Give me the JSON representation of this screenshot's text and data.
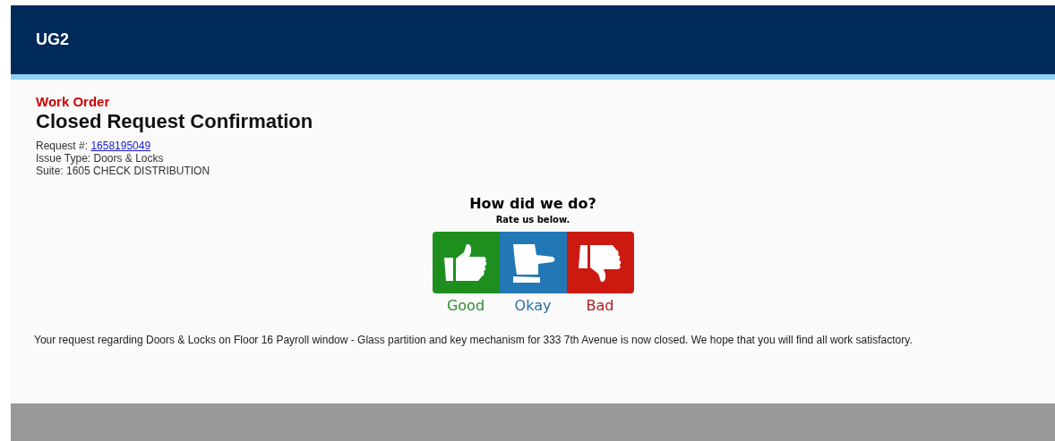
{
  "header": {
    "title": "UG2"
  },
  "page": {
    "eyebrow": "Work Order",
    "title": "Closed Request Confirmation"
  },
  "details": {
    "request_label": "Request #:",
    "request_number": "1658195049",
    "issue_type": "Issue Type: Doors & Locks",
    "suite": "Suite: 1605 CHECK DISTRIBUTION"
  },
  "rating": {
    "question": "How did we do?",
    "prompt": "Rate us below.",
    "options": [
      {
        "kind": "up",
        "label": "Good",
        "color": "#1e8f1e"
      },
      {
        "kind": "side",
        "label": "Okay",
        "color": "#2277b5"
      },
      {
        "kind": "down",
        "label": "Bad",
        "color": "#cc1a10"
      }
    ]
  },
  "message": "Your request regarding Doors & Locks on Floor 16 Payroll window - Glass partition and key mechanism for 333 7th Avenue is now closed. We hope that you will find all work satisfactory."
}
